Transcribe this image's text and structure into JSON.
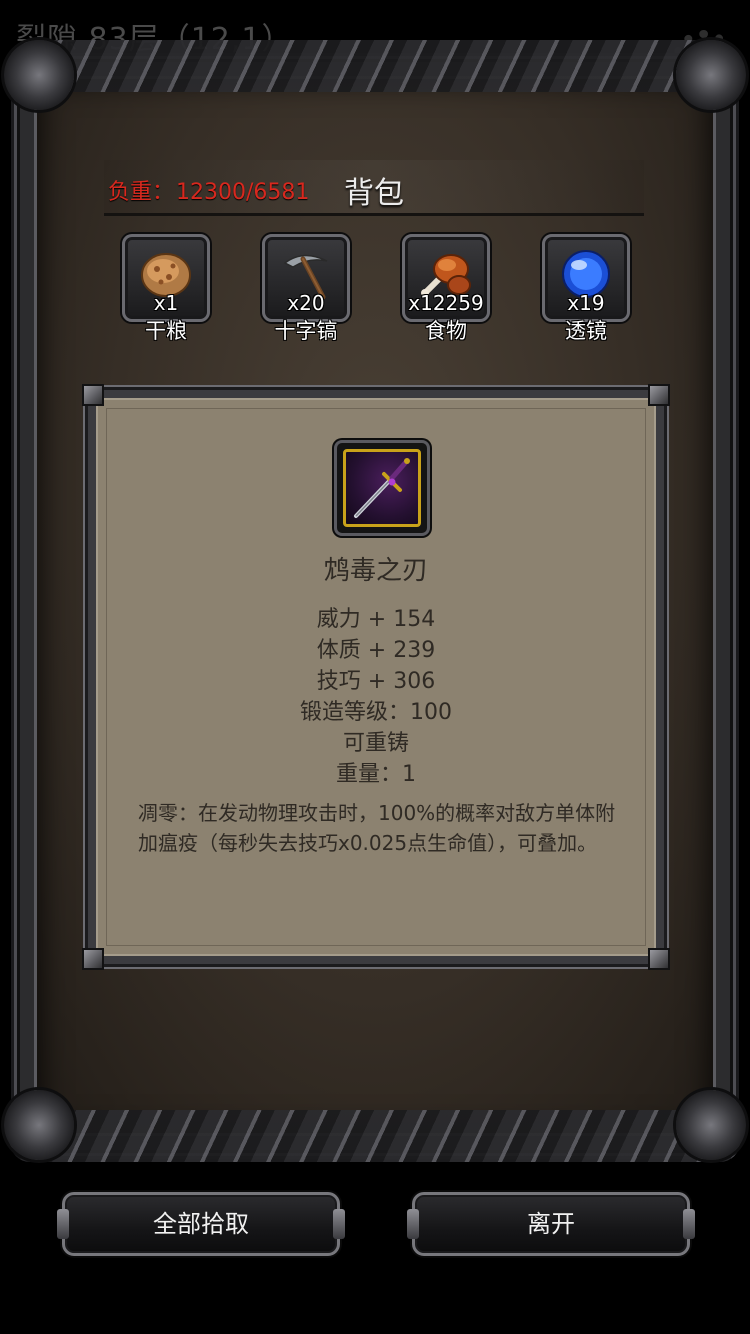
{
  "background_header": {
    "location": "裂隙 83层（12,1）"
  },
  "header": {
    "weight_label": "负重：",
    "weight_value": "12300/6581",
    "title": "背包"
  },
  "inventory": [
    {
      "icon": "dry-ration-icon",
      "count": "x1",
      "name": "干粮"
    },
    {
      "icon": "pickaxe-icon",
      "count": "x20",
      "name": "十字镐"
    },
    {
      "icon": "food-meat-icon",
      "count": "x12259",
      "name": "食物"
    },
    {
      "icon": "lens-orb-icon",
      "count": "x19",
      "name": "透镜"
    }
  ],
  "item_detail": {
    "icon": "dagger-icon",
    "name": "鸩毒之刃",
    "stats": [
      "威力 + 154",
      "体质 + 239",
      "技巧 + 306",
      "锻造等级：100",
      "可重铸",
      "重量：1"
    ],
    "description": "凋零：在发动物理攻击时，100%的概率对敌方单体附加瘟疫（每秒失去技巧x0.025点生命值），可叠加。"
  },
  "buttons": {
    "pick_all": "全部拾取",
    "leave": "离开"
  },
  "colors": {
    "weight_text": "#d8281e",
    "panel_bg": "#8c8270",
    "item_rarity_border": "#c9a21a"
  }
}
